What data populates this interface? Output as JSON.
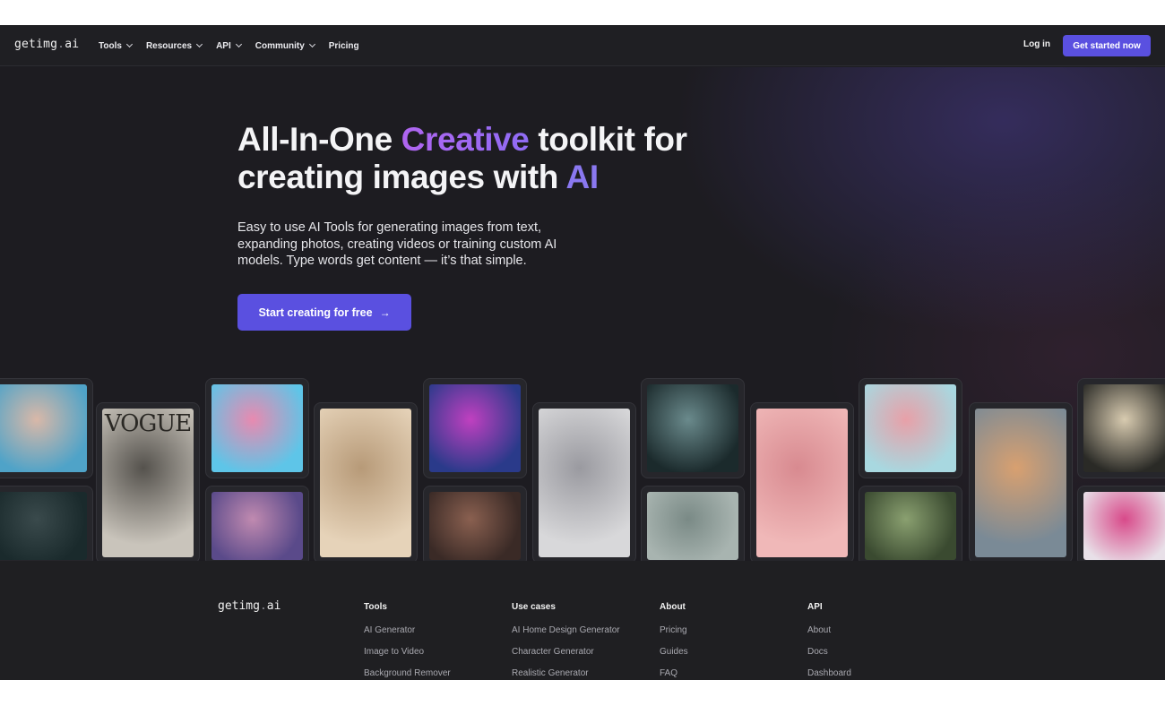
{
  "nav": {
    "logo_main": "getimg",
    "logo_dot": ".",
    "logo_tld": "ai",
    "links": [
      "Tools",
      "Resources",
      "API",
      "Community",
      "Pricing"
    ],
    "login": "Log in",
    "cta": "Get started now"
  },
  "hero": {
    "title_part1": "All-In-One ",
    "title_highlight1": "Creative",
    "title_part2": " toolkit for creating images with ",
    "title_highlight2": "AI",
    "subtitle": "Easy to use AI Tools for generating images from text, expanding photos, creating videos or training custom AI models. Type words get content — it’s that simple.",
    "cta": "Start creating for free",
    "cta_arrow": "→"
  },
  "gallery": {
    "tiles": [
      {
        "name": "woman-face-water",
        "colors": [
          "#4fa3c8",
          "#d9b8a8"
        ]
      },
      {
        "name": "vogue-cover-statue",
        "colors": [
          "#c9c4bb",
          "#55524d"
        ],
        "text": "VOGUE"
      },
      {
        "name": "crystal-sphere-mountains",
        "colors": [
          "#5ec5e8",
          "#e88ab0"
        ]
      },
      {
        "name": "minimal-bedroom",
        "colors": [
          "#e6d3b9",
          "#b79a78"
        ]
      },
      {
        "name": "neon-robot-heart",
        "colors": [
          "#2a3a8a",
          "#c040c0"
        ]
      },
      {
        "name": "wire-sculpture-head",
        "colors": [
          "#d8d8da",
          "#9a9aa0"
        ]
      },
      {
        "name": "alien-face",
        "colors": [
          "#1b2a2c",
          "#6a8a8c"
        ]
      },
      {
        "name": "pink-teddy-room",
        "colors": [
          "#f0b8b8",
          "#d88a90"
        ]
      },
      {
        "name": "glass-figure-walking",
        "colors": [
          "#a8d8e0",
          "#e8a0a8"
        ]
      },
      {
        "name": "astronaut-door",
        "colors": [
          "#7a8a96",
          "#d8a070"
        ]
      },
      {
        "name": "cracked-porcelain-bust",
        "colors": [
          "#2a2a26",
          "#d8cbb0"
        ]
      },
      {
        "name": "dark-portrait-red-eye",
        "colors": [
          "#1a2a2c",
          "#3a4a4c"
        ]
      },
      {
        "name": "cyberpunk-medusa",
        "colors": [
          "#5a4a8a",
          "#c08ab0"
        ]
      },
      {
        "name": "face-green-eyes",
        "colors": [
          "#3a2a26",
          "#8a6050"
        ]
      },
      {
        "name": "misty-figure",
        "colors": [
          "#a8b4b0",
          "#7a8a86"
        ]
      },
      {
        "name": "greenhouse-interior",
        "colors": [
          "#3a4a30",
          "#8aa070"
        ]
      },
      {
        "name": "balloon-tree",
        "colors": [
          "#e8e0e8",
          "#d84a8a"
        ]
      }
    ]
  },
  "footer": {
    "logo_main": "getimg",
    "logo_dot": ".",
    "logo_tld": "ai",
    "columns": [
      {
        "title": "Tools",
        "links": [
          "AI Generator",
          "Image to Video",
          "Background Remover"
        ]
      },
      {
        "title": "Use cases",
        "links": [
          "AI Home Design Generator",
          "Character Generator",
          "Realistic Generator"
        ]
      },
      {
        "title": "About",
        "links": [
          "Pricing",
          "Guides",
          "FAQ"
        ]
      },
      {
        "title": "API",
        "links": [
          "About",
          "Docs",
          "Dashboard"
        ]
      }
    ]
  }
}
